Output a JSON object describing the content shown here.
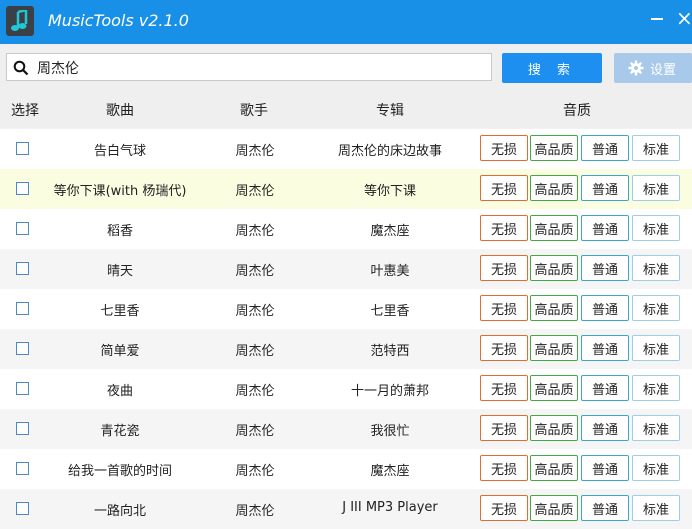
{
  "app": {
    "title": "MusicTools v2.1.0"
  },
  "search": {
    "value": "周杰伦",
    "button_label": "搜 索"
  },
  "settings": {
    "label": "设置"
  },
  "columns": {
    "select": "选择",
    "song": "歌曲",
    "artist": "歌手",
    "album": "专辑",
    "quality": "音质"
  },
  "quality_labels": {
    "lossless": "无损",
    "high": "高品质",
    "normal": "普通",
    "standard": "标准"
  },
  "rows": [
    {
      "song": "告白气球",
      "artist": "周杰伦",
      "album": "周杰伦的床边故事"
    },
    {
      "song": "等你下课(with 杨瑞代)",
      "artist": "周杰伦",
      "album": "等你下课"
    },
    {
      "song": "稻香",
      "artist": "周杰伦",
      "album": "魔杰座"
    },
    {
      "song": "晴天",
      "artist": "周杰伦",
      "album": "叶惠美"
    },
    {
      "song": "七里香",
      "artist": "周杰伦",
      "album": "七里香"
    },
    {
      "song": "简单爱",
      "artist": "周杰伦",
      "album": "范特西"
    },
    {
      "song": "夜曲",
      "artist": "周杰伦",
      "album": "十一月的萧邦"
    },
    {
      "song": "青花瓷",
      "artist": "周杰伦",
      "album": "我很忙"
    },
    {
      "song": "给我一首歌的时间",
      "artist": "周杰伦",
      "album": "魔杰座"
    },
    {
      "song": "一路向北",
      "artist": "周杰伦",
      "album": "J III MP3 Player"
    }
  ]
}
